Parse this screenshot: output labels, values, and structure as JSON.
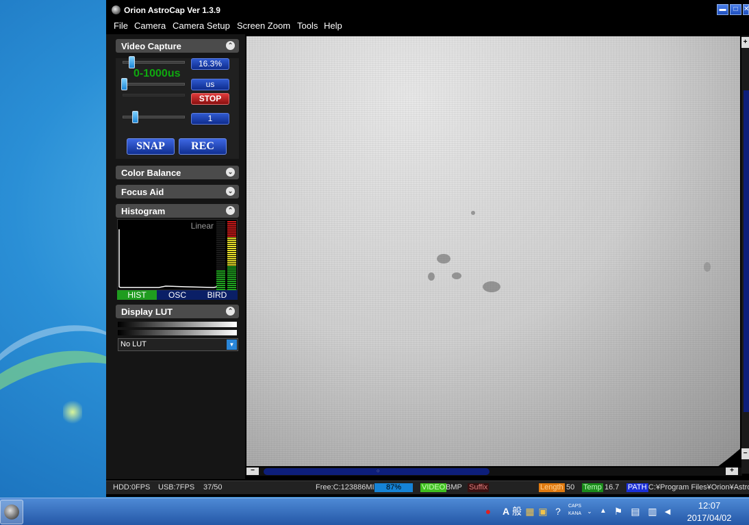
{
  "window": {
    "title": "Orion AstroCap Ver 1.3.9",
    "controls": {
      "minimize": "▬",
      "maximize": "□",
      "close": "✕"
    }
  },
  "menu": [
    "File",
    "Camera",
    "Camera Setup",
    "Screen Zoom",
    "Tools",
    "Help"
  ],
  "video_capture": {
    "title": "Video Capture",
    "gain_value": "16.3%",
    "exposure_range": "0-1000us",
    "unit": "us",
    "stop_label": "STOP",
    "frame_value": "1",
    "snap_label": "SNAP",
    "rec_label": "REC",
    "gain_level": 0.12,
    "exposure_level": 0.0,
    "frame_level": 0.18
  },
  "sections": {
    "color_balance": "Color Balance",
    "focus_aid": "Focus Aid",
    "histogram": "Histogram",
    "display_lut": "Display LUT"
  },
  "histogram": {
    "scale_label": "Linear",
    "tabs": [
      "HIST",
      "OSC",
      "BIRD"
    ],
    "active_tab": "HIST"
  },
  "lut": {
    "selected": "No LUT"
  },
  "status_bar": {
    "hdd": "HDD:0FPS",
    "usb": "USB:7FPS",
    "frames": "37/50",
    "free": "Free:C:123886MI",
    "percent": "87%",
    "video_tag": "VIDEO",
    "format": "BMP",
    "suffix": "Suffix",
    "length_tag": "Length",
    "length_value": "50",
    "temp_tag": "Temp",
    "temp_value": "16.7",
    "path_tag": "PATH",
    "path_value": "C:¥Program Files¥Orion¥Astro"
  },
  "taskbar": {
    "ime_mode": "A",
    "ime_kanji": "般",
    "caps": "CAPS",
    "kana": "KANA",
    "time": "12:07",
    "date": "2017/04/02"
  },
  "colors": {
    "accent_blue": "#0e2c8e",
    "stop_red": "#8a0f0f",
    "range_green": "#0fa90f",
    "video_tag_bg": "#3fbf1f",
    "length_tag_bg": "#e07a10",
    "temp_tag_bg": "#1a8a1a",
    "path_tag_bg": "#1a2fd6"
  }
}
